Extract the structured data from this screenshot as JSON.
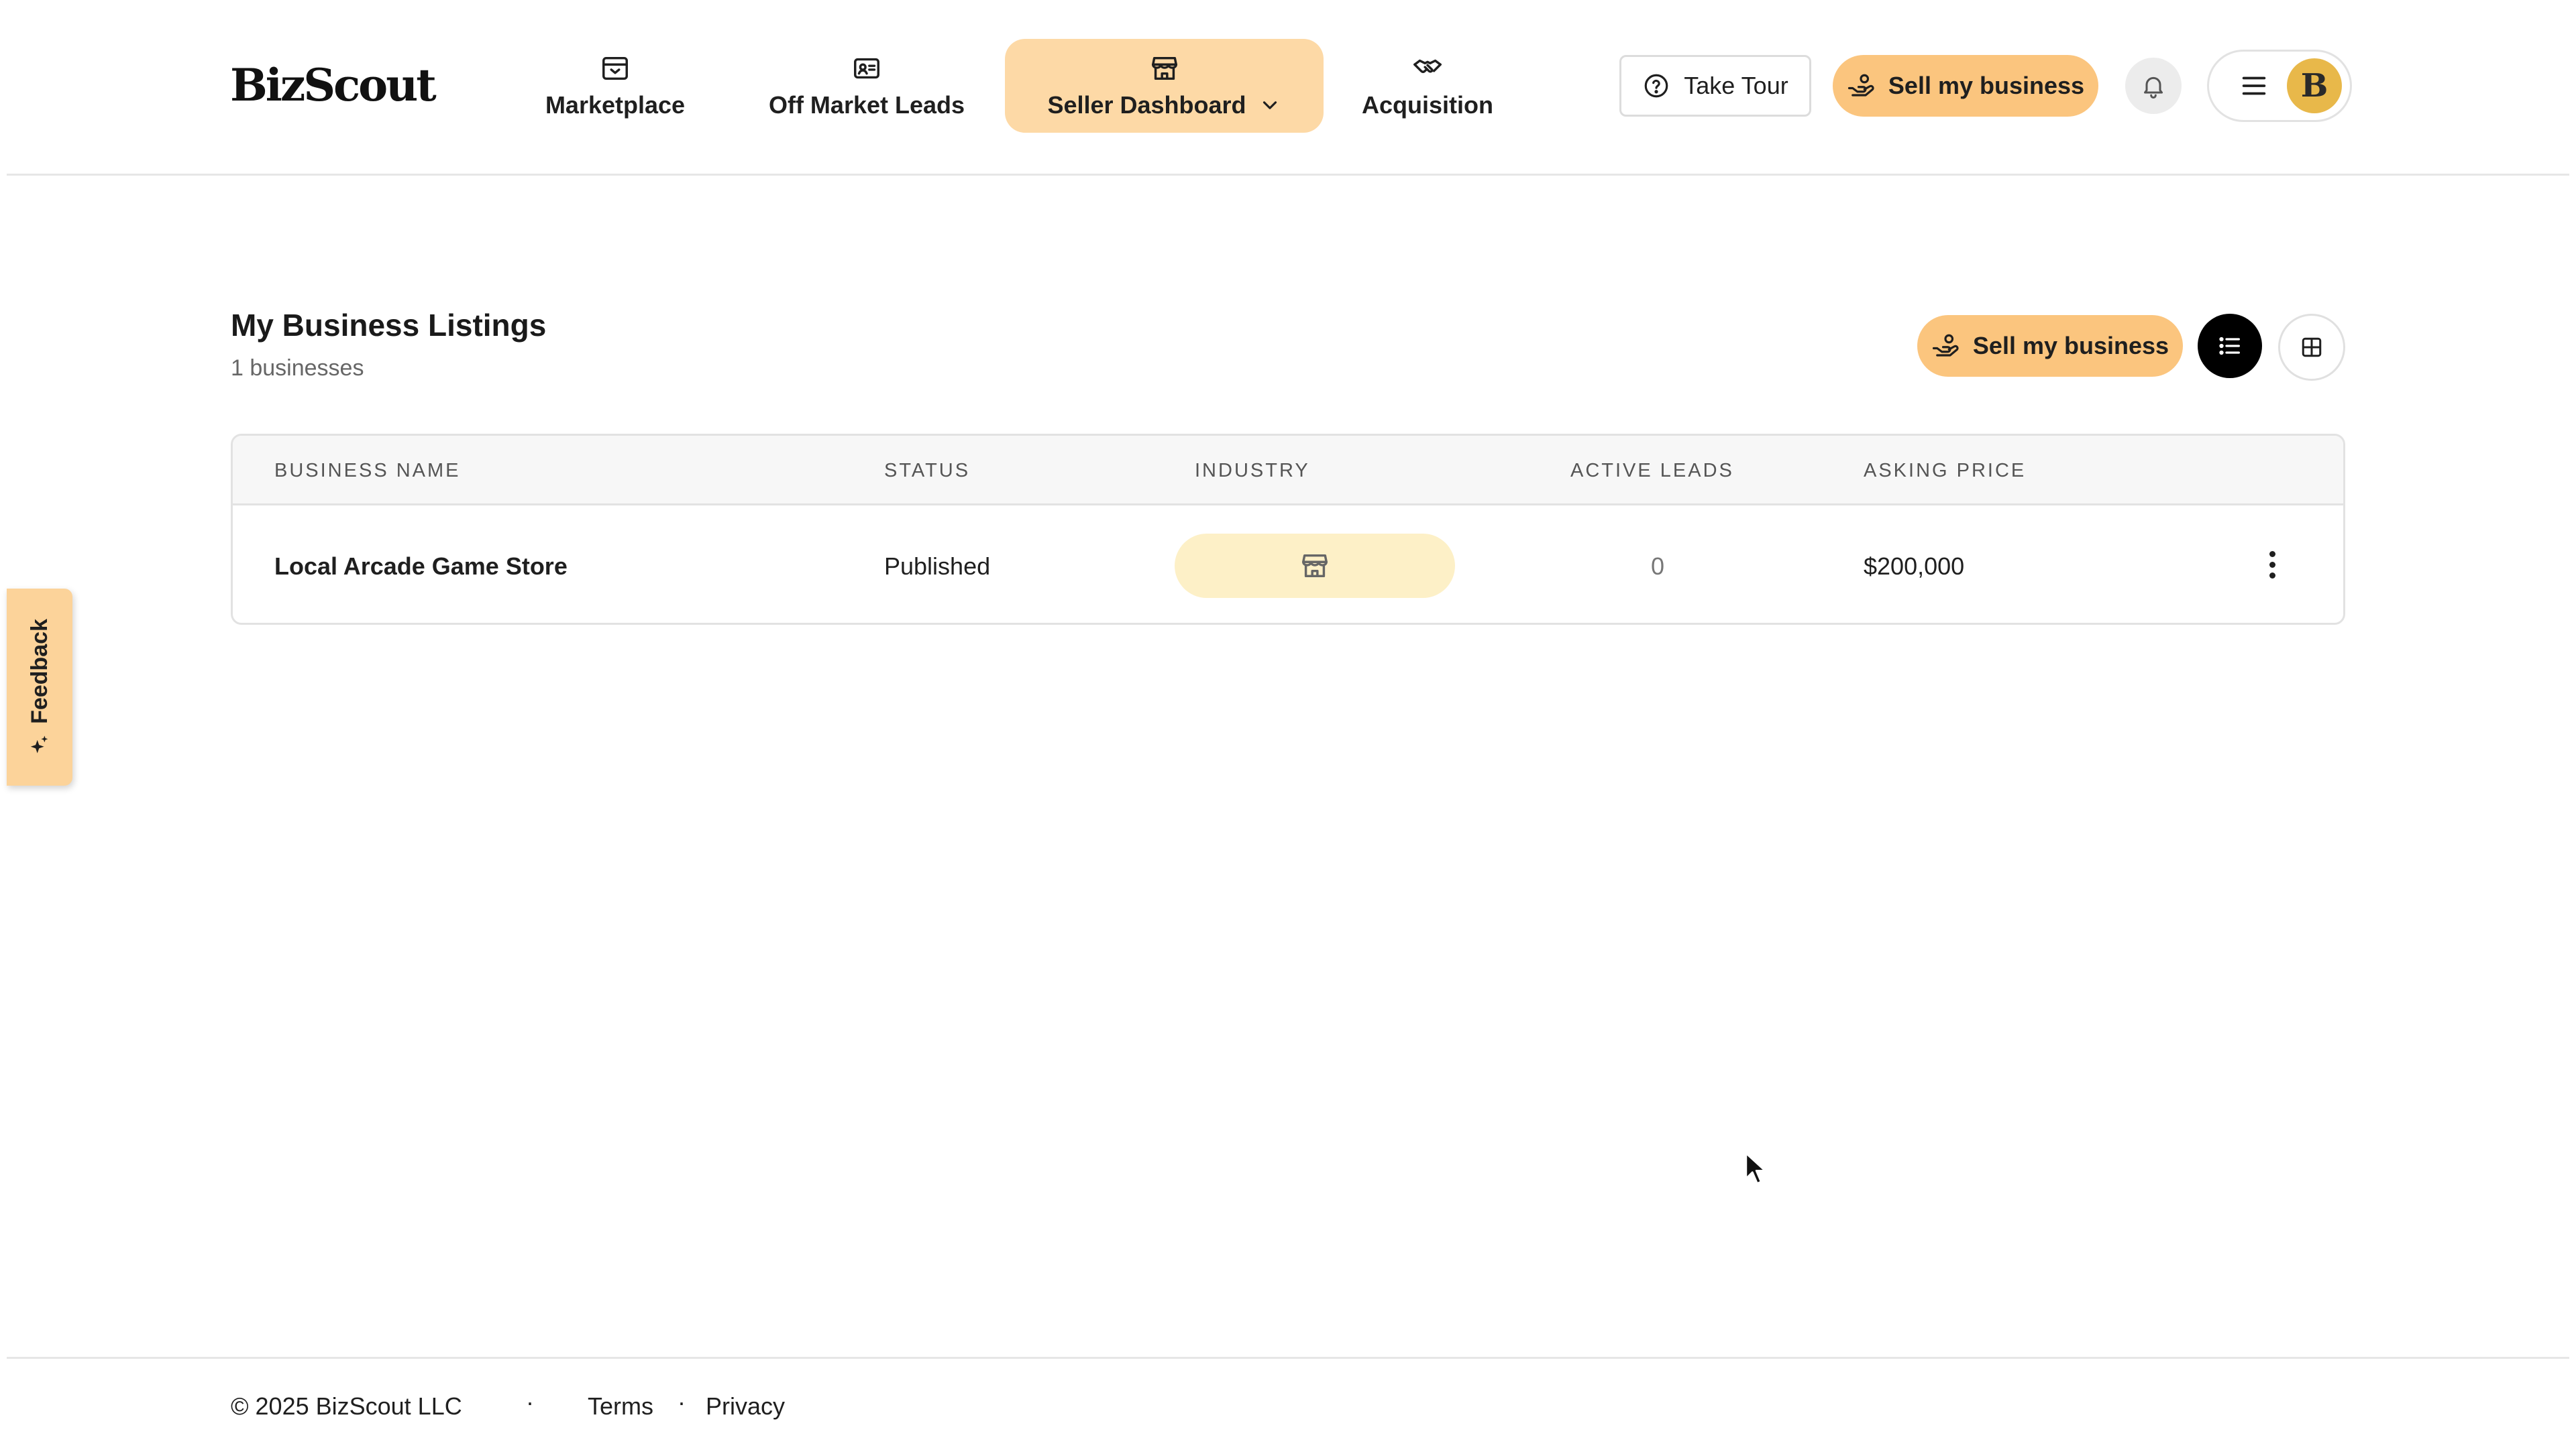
{
  "brand": {
    "name": "BizScout"
  },
  "nav": {
    "marketplace": "Marketplace",
    "off_market": "Off Market Leads",
    "seller_dashboard": "Seller Dashboard",
    "acquisition": "Acquisition"
  },
  "header": {
    "take_tour": "Take Tour",
    "sell_business": "Sell my business",
    "avatar_initial": "B"
  },
  "page": {
    "title": "My Business Listings",
    "subtitle": "1 businesses",
    "sell_business": "Sell my business"
  },
  "table": {
    "columns": [
      "BUSINESS NAME",
      "STATUS",
      "INDUSTRY",
      "ACTIVE LEADS",
      "ASKING PRICE"
    ],
    "rows": [
      {
        "name": "Local Arcade Game Store",
        "status": "Published",
        "industry_icon": "storefront-icon",
        "active_leads": "0",
        "asking_price": "$200,000"
      }
    ]
  },
  "feedback": {
    "label": "Feedback"
  },
  "footer": {
    "copyright": "© 2025 BizScout LLC",
    "separator": "·",
    "terms": "Terms",
    "privacy": "Privacy"
  },
  "colors": {
    "accent": "#fbc57e",
    "active_nav": "#fdd9a6",
    "industry_pill": "#fdf0c7",
    "avatar": "#e8b84a"
  }
}
